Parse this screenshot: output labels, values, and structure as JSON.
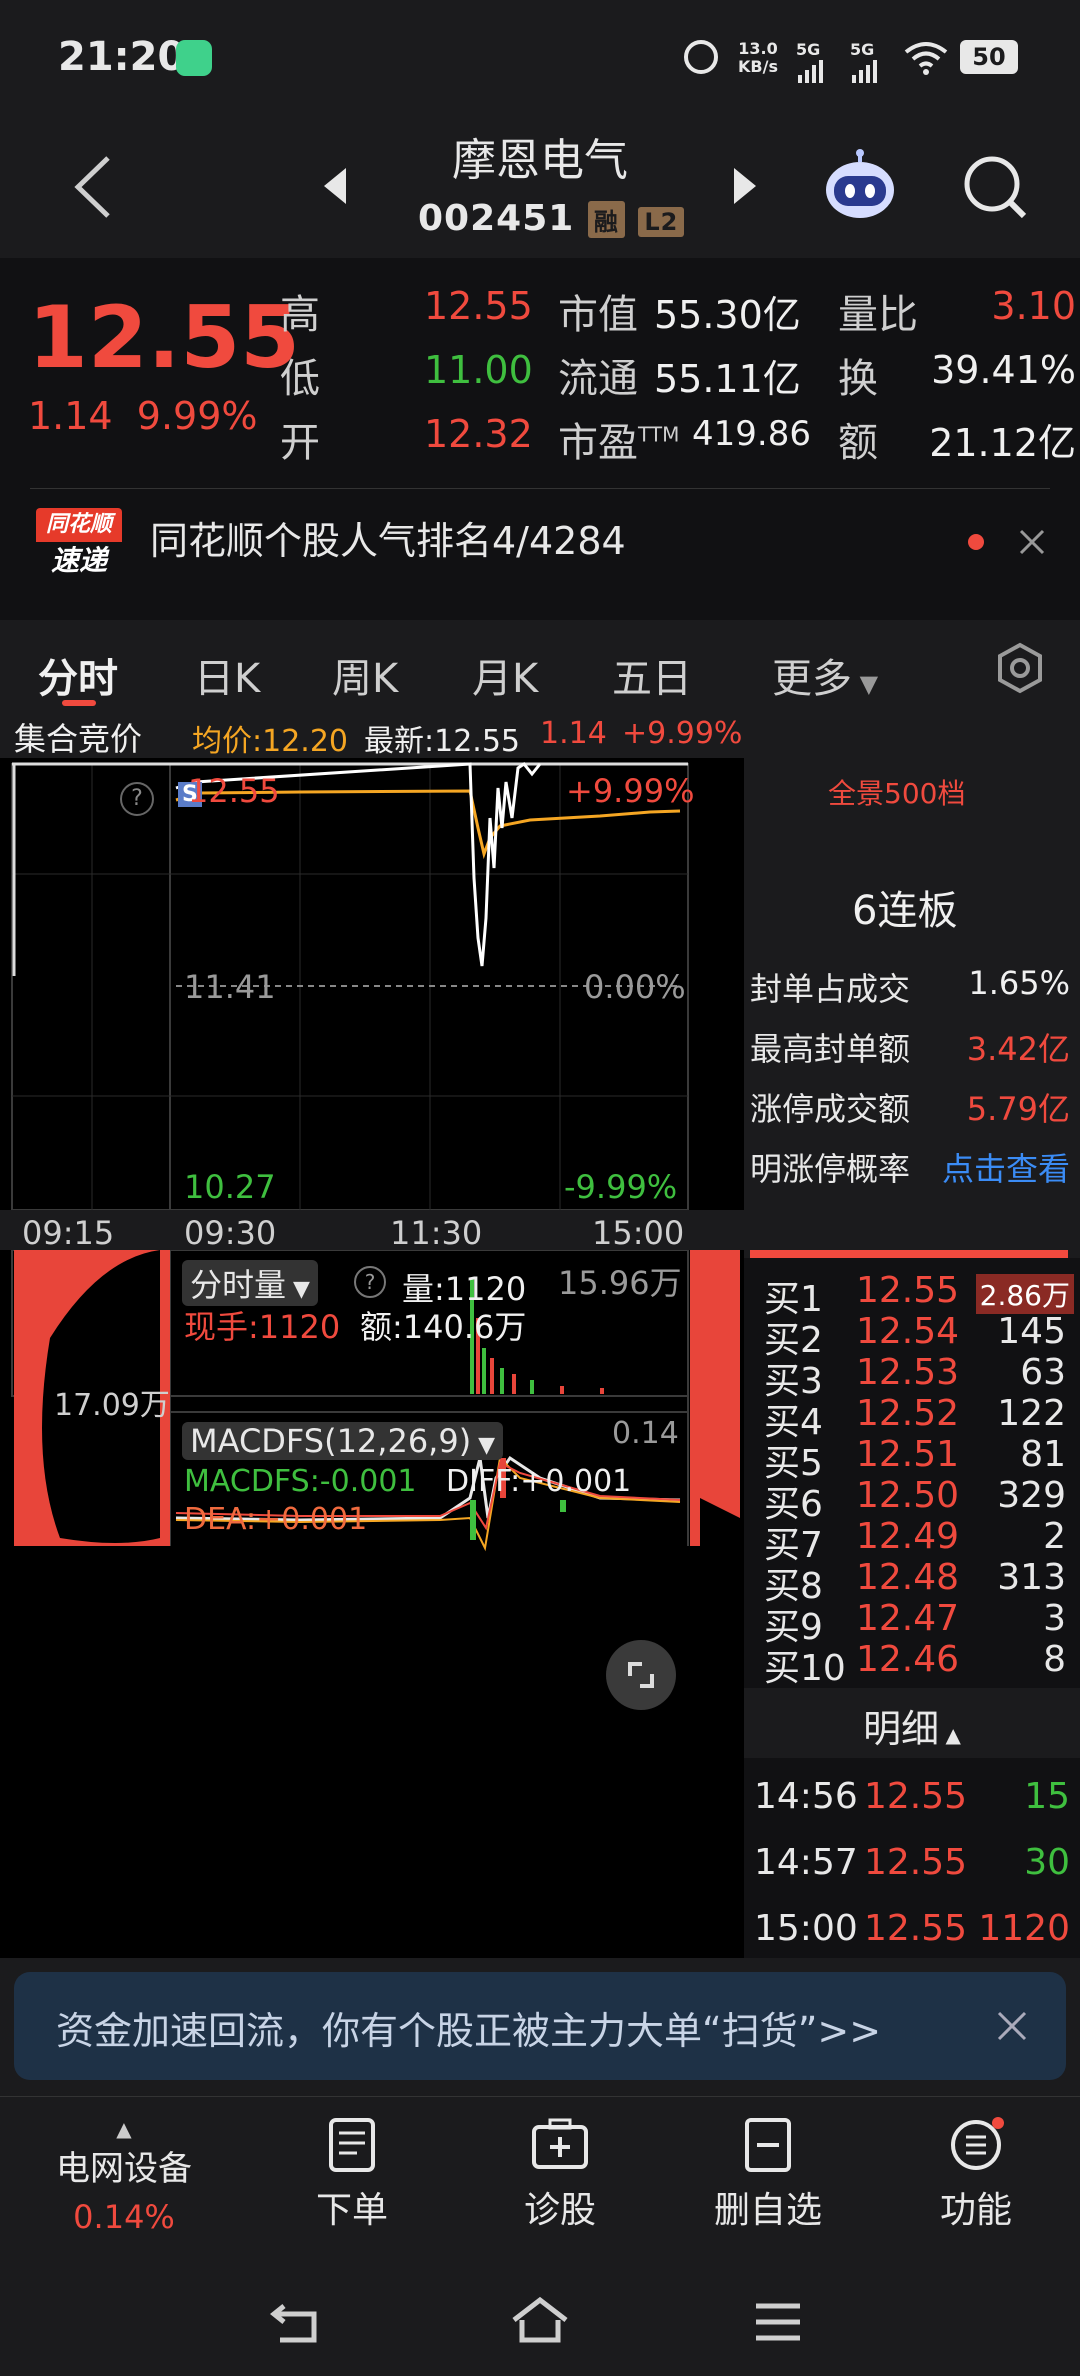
{
  "status_bar": {
    "time": "21:20",
    "net_speed_top": "13.0",
    "net_speed_unit": "KB/s",
    "sig1": "5G",
    "sig2": "5G",
    "battery": "50"
  },
  "header": {
    "name": "摩恩电气",
    "code": "002451",
    "tag_rong": "融",
    "tag_l2": "L2"
  },
  "quote": {
    "price": "12.55",
    "change": "1.14",
    "change_pct": "9.99%",
    "high_label": "高",
    "high": "12.55",
    "low_label": "低",
    "low": "11.00",
    "open_label": "开",
    "open": "12.32",
    "mcap_label": "市值",
    "mcap": "55.30亿",
    "float_label": "流通",
    "float": "55.11亿",
    "pe_label": "市盈",
    "pe_sup": "TTM",
    "pe": "419.86",
    "vr_label": "量比",
    "vr": "3.10",
    "turn_label": "换",
    "turn": "39.41%",
    "amt_label": "额",
    "amt": "21.12亿"
  },
  "news": {
    "logo_top": "同花顺",
    "logo_bottom": "速递",
    "text": "同花顺个股人气排名4/4284"
  },
  "tabs": [
    "分时",
    "日K",
    "周K",
    "月K",
    "五日",
    "更多"
  ],
  "info_line": {
    "label": "集合竞价",
    "avg": "均价:12.20",
    "latest": "最新:12.55",
    "chg": "1.14",
    "chg_pct": "+9.99%"
  },
  "chart": {
    "top_price": "12.55",
    "top_pct": "+9.99%",
    "mid_price": "11.41",
    "mid_pct": "0.00%",
    "bot_price": "10.27",
    "bot_pct": "-9.99%",
    "s_badge": "S",
    "times": [
      "09:15",
      "09:30",
      "11:30",
      "15:00"
    ],
    "vol_label_left": "17.09万",
    "vol_mode": "分时量",
    "vol": "量:1120",
    "vol_right": "15.96万",
    "cur_hand": "现手:1120",
    "amount": "额:140.6万",
    "macd_title": "MACDFS(12,26,9)",
    "macd_val": "0.14",
    "macdfs": "MACDFS:-0.001",
    "diff": "DIFF:+0.001",
    "dea": "DEA:+0.001",
    "colors": {
      "price_line": "#ffffff",
      "avg_line": "#f5a623",
      "up": "#f04a3e",
      "down": "#3fbf3f"
    }
  },
  "right_panel": {
    "full_500": "全景500档",
    "streak": "6连板",
    "rows": [
      {
        "label": "封单占成交",
        "value": "1.65%"
      },
      {
        "label": "最高封单额",
        "value": "3.42亿"
      },
      {
        "label": "涨停成交额",
        "value": "5.79亿"
      },
      {
        "label": "明涨停概率",
        "value": "点击查看"
      }
    ],
    "orderbook": [
      {
        "label": "买1",
        "price": "12.55",
        "vol": "2.86万"
      },
      {
        "label": "买2",
        "price": "12.54",
        "vol": "145"
      },
      {
        "label": "买3",
        "price": "12.53",
        "vol": "63"
      },
      {
        "label": "买4",
        "price": "12.52",
        "vol": "122"
      },
      {
        "label": "买5",
        "price": "12.51",
        "vol": "81"
      },
      {
        "label": "买6",
        "price": "12.50",
        "vol": "329"
      },
      {
        "label": "买7",
        "price": "12.49",
        "vol": "2"
      },
      {
        "label": "买8",
        "price": "12.48",
        "vol": "313"
      },
      {
        "label": "买9",
        "price": "12.47",
        "vol": "3"
      },
      {
        "label": "买10",
        "price": "12.46",
        "vol": "8"
      }
    ],
    "detail_title": "明细",
    "details": [
      {
        "time": "14:56",
        "price": "12.55",
        "vol": "15"
      },
      {
        "time": "14:57",
        "price": "12.55",
        "vol": "30"
      },
      {
        "time": "15:00",
        "price": "12.55",
        "vol": "1120"
      }
    ]
  },
  "ad_banner": {
    "text": "资金加速回流，你有个股正被主力大单“扫货”>>"
  },
  "bottom_nav": {
    "sector": "电网设备",
    "sector_pct": "0.14%",
    "items": [
      "下单",
      "诊股",
      "删自选",
      "功能"
    ]
  }
}
